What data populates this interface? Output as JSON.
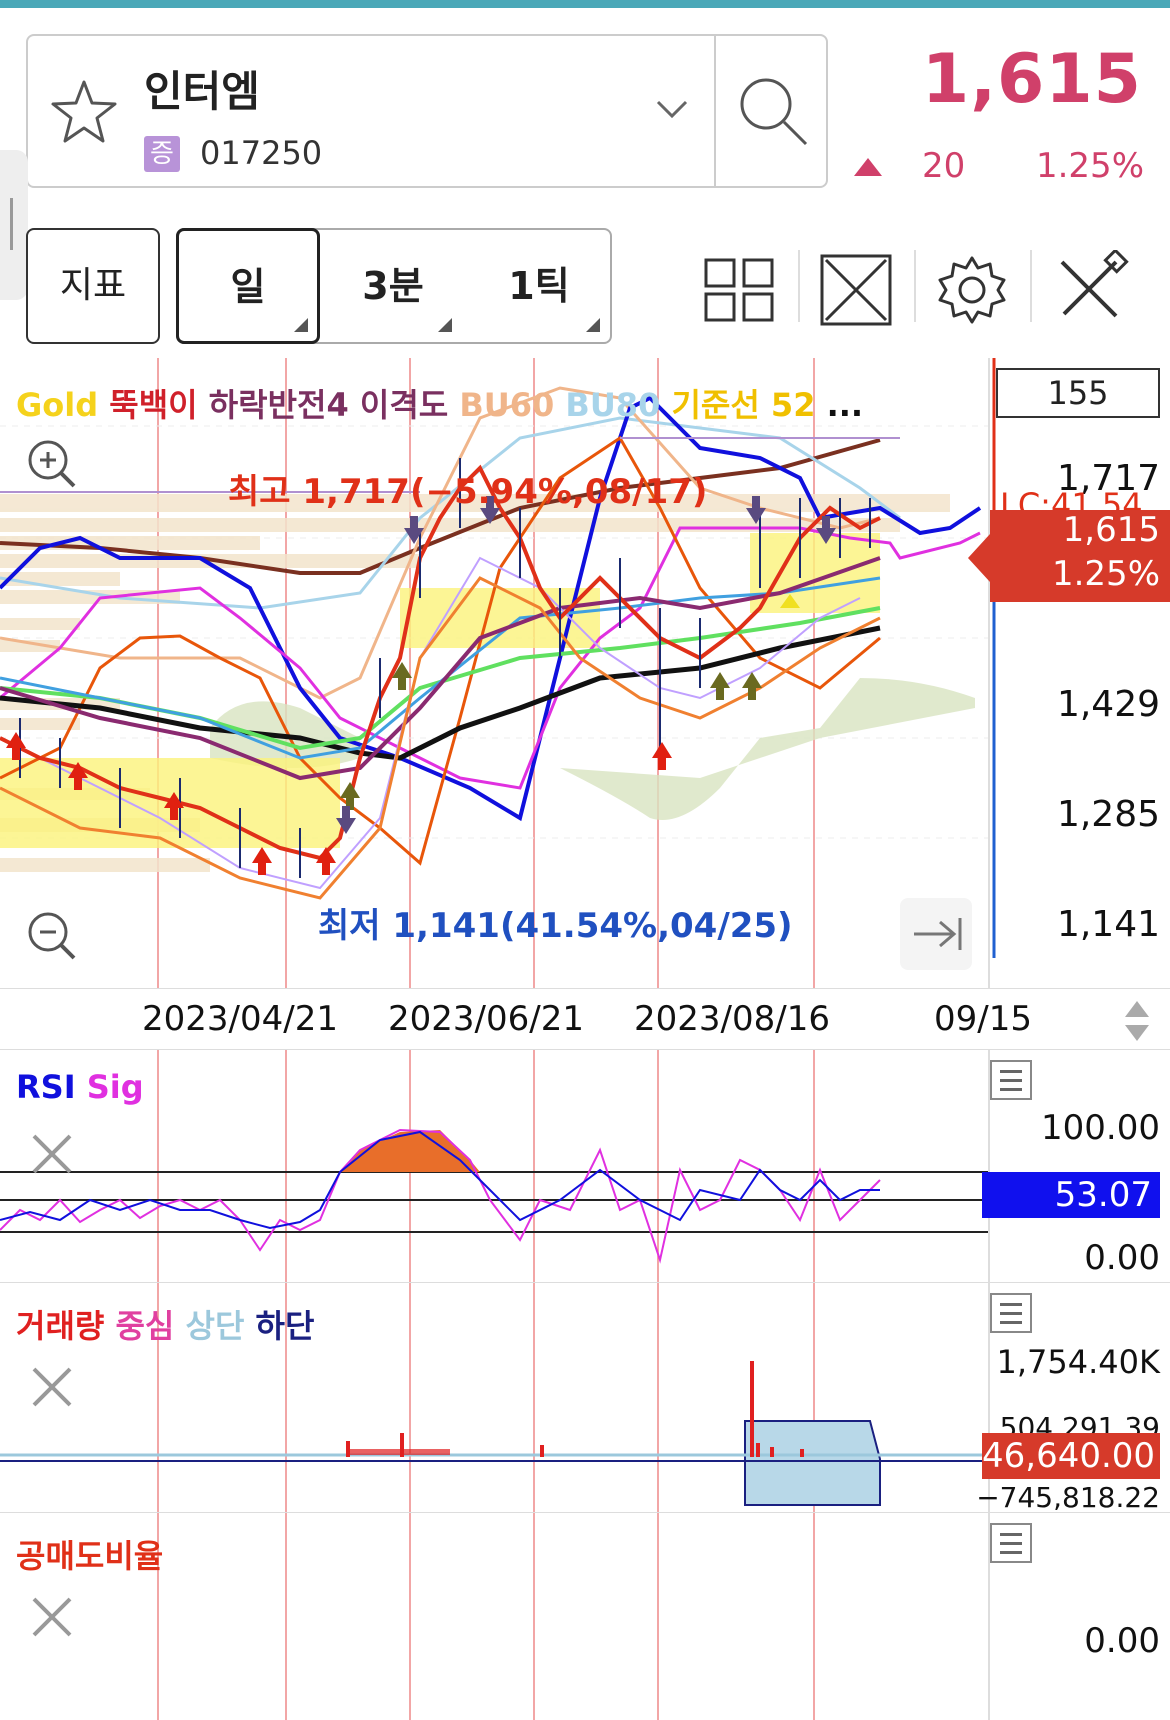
{
  "stock": {
    "name": "인터엠",
    "badge": "증",
    "code": "017250",
    "price": "1,615",
    "change": "20",
    "change_pct": "1.25%",
    "up_color": "#d0406a"
  },
  "toolbar": {
    "indicator_label": "지표",
    "periods": [
      "일",
      "3분",
      "1틱"
    ],
    "selected_period": "일",
    "icons": [
      "layout-icon",
      "fullscreen-icon",
      "settings-icon",
      "tools-icon"
    ]
  },
  "main_chart": {
    "legend": [
      {
        "text": "Gold",
        "color": "#f5d21c"
      },
      {
        "text": "뚝백이",
        "color": "#d0202a"
      },
      {
        "text": "하락반전4",
        "color": "#7a3060"
      },
      {
        "text": "이격도",
        "color": "#7a3060"
      },
      {
        "text": "BU60",
        "color": "#f0b58a"
      },
      {
        "text": "BU80",
        "color": "#a8d4ea"
      },
      {
        "text": "기준선 52",
        "color": "#f0c000"
      },
      {
        "text": "...",
        "color": "#111"
      }
    ],
    "high_note": "최고 1,717(−5.94%,08/17)",
    "low_note": "최저 1,141(41.54%,04/25)",
    "y_ticks": [
      "1,717",
      "1,429",
      "1,285",
      "1,141"
    ],
    "top_value_box": "155",
    "overlay_label": "LC:41.54",
    "price_tag_price": "1,615",
    "price_tag_pct": "1.25%",
    "x_labels": [
      "2023/04/21",
      "2023/06/21",
      "2023/08/16",
      "09/15"
    ]
  },
  "rsi_panel": {
    "title_rsi": "RSI",
    "title_sig": "Sig",
    "top": "100.00",
    "current": "53.07",
    "bottom": "0.00"
  },
  "volume_panel": {
    "title_parts": [
      {
        "text": "거래량",
        "color": "#e02020"
      },
      {
        "text": "중심",
        "color": "#e040a0"
      },
      {
        "text": "상단",
        "color": "#9cc8dc"
      },
      {
        "text": "하단",
        "color": "#1a2080"
      }
    ],
    "max": "1,754.40K",
    "upper": "504,291.39",
    "current": "46,640.00",
    "lower": "−745,818.22"
  },
  "short_panel": {
    "title": "공매도비율",
    "value": "0.00"
  },
  "chart_data": {
    "type": "line",
    "title": "",
    "x": [
      "2023/04/21",
      "2023/06/21",
      "2023/08/16",
      "09/15"
    ],
    "ylim": [
      1141,
      1717
    ],
    "series": [
      {
        "name": "",
        "values": [
          1141,
          1717,
          1615
        ]
      }
    ]
  }
}
